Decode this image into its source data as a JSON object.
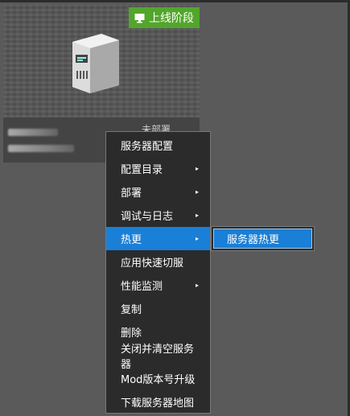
{
  "card": {
    "stage_badge": "上线阶段",
    "deploy_status": "未部署"
  },
  "context_menu": {
    "items": [
      {
        "label": "服务器配置",
        "has_submenu": false
      },
      {
        "label": "配置目录",
        "has_submenu": true
      },
      {
        "label": "部署",
        "has_submenu": true
      },
      {
        "label": "调试与日志",
        "has_submenu": true
      },
      {
        "label": "热更",
        "has_submenu": true,
        "active": true
      },
      {
        "label": "应用快速切服",
        "has_submenu": false
      },
      {
        "label": "性能监测",
        "has_submenu": true
      },
      {
        "label": "复制",
        "has_submenu": false
      },
      {
        "label": "删除",
        "has_submenu": false
      },
      {
        "label": "关闭并清空服务器",
        "has_submenu": false
      },
      {
        "label": "Mod版本号升级",
        "has_submenu": false
      },
      {
        "label": "下载服务器地图",
        "has_submenu": false
      }
    ],
    "arrow": "▸"
  },
  "submenu": {
    "items": [
      {
        "label": "服务器热更"
      }
    ]
  },
  "colors": {
    "background": "#5a5a5a",
    "menu_bg": "#2b2b2b",
    "highlight": "#1a7fd6",
    "badge_green": "#52a62b"
  },
  "icons": [
    "monitor-icon",
    "server-icon",
    "chevron-right-icon"
  ]
}
